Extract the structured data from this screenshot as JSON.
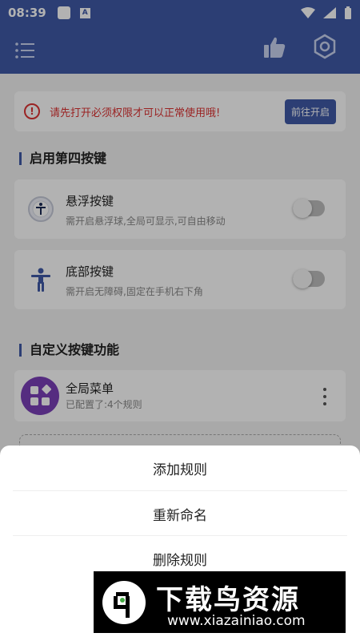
{
  "status_bar": {
    "time": "08:39",
    "a_badge": "A"
  },
  "app_bar": {
    "icons": [
      "menu-icon",
      "thumbs-up-icon",
      "gear-icon"
    ]
  },
  "warning": {
    "text": "请先打开必须权限才可以正常使用哦!",
    "button": "前往开启"
  },
  "section_fourth_key": {
    "title": "启用第四按键"
  },
  "float_key": {
    "title": "悬浮按键",
    "desc": "需开启悬浮球,全局可显示,可自由移动",
    "enabled": false
  },
  "bottom_key": {
    "title": "底部按键",
    "desc": "需开启无障碍,固定在手机右下角",
    "enabled": false
  },
  "section_custom": {
    "title": "自定义按键功能"
  },
  "rule_item": {
    "title": "全局菜单",
    "subtitle": "已配置了:4个规则"
  },
  "sheet": {
    "items": [
      "添加规则",
      "重新命名",
      "删除规则"
    ]
  },
  "watermark": {
    "title": "下载鸟资源",
    "url": "www.xiazainiao.com"
  },
  "colors": {
    "primary": "#3f5aa6",
    "warning": "#dd3333",
    "avatar": "#7a3fb8"
  }
}
